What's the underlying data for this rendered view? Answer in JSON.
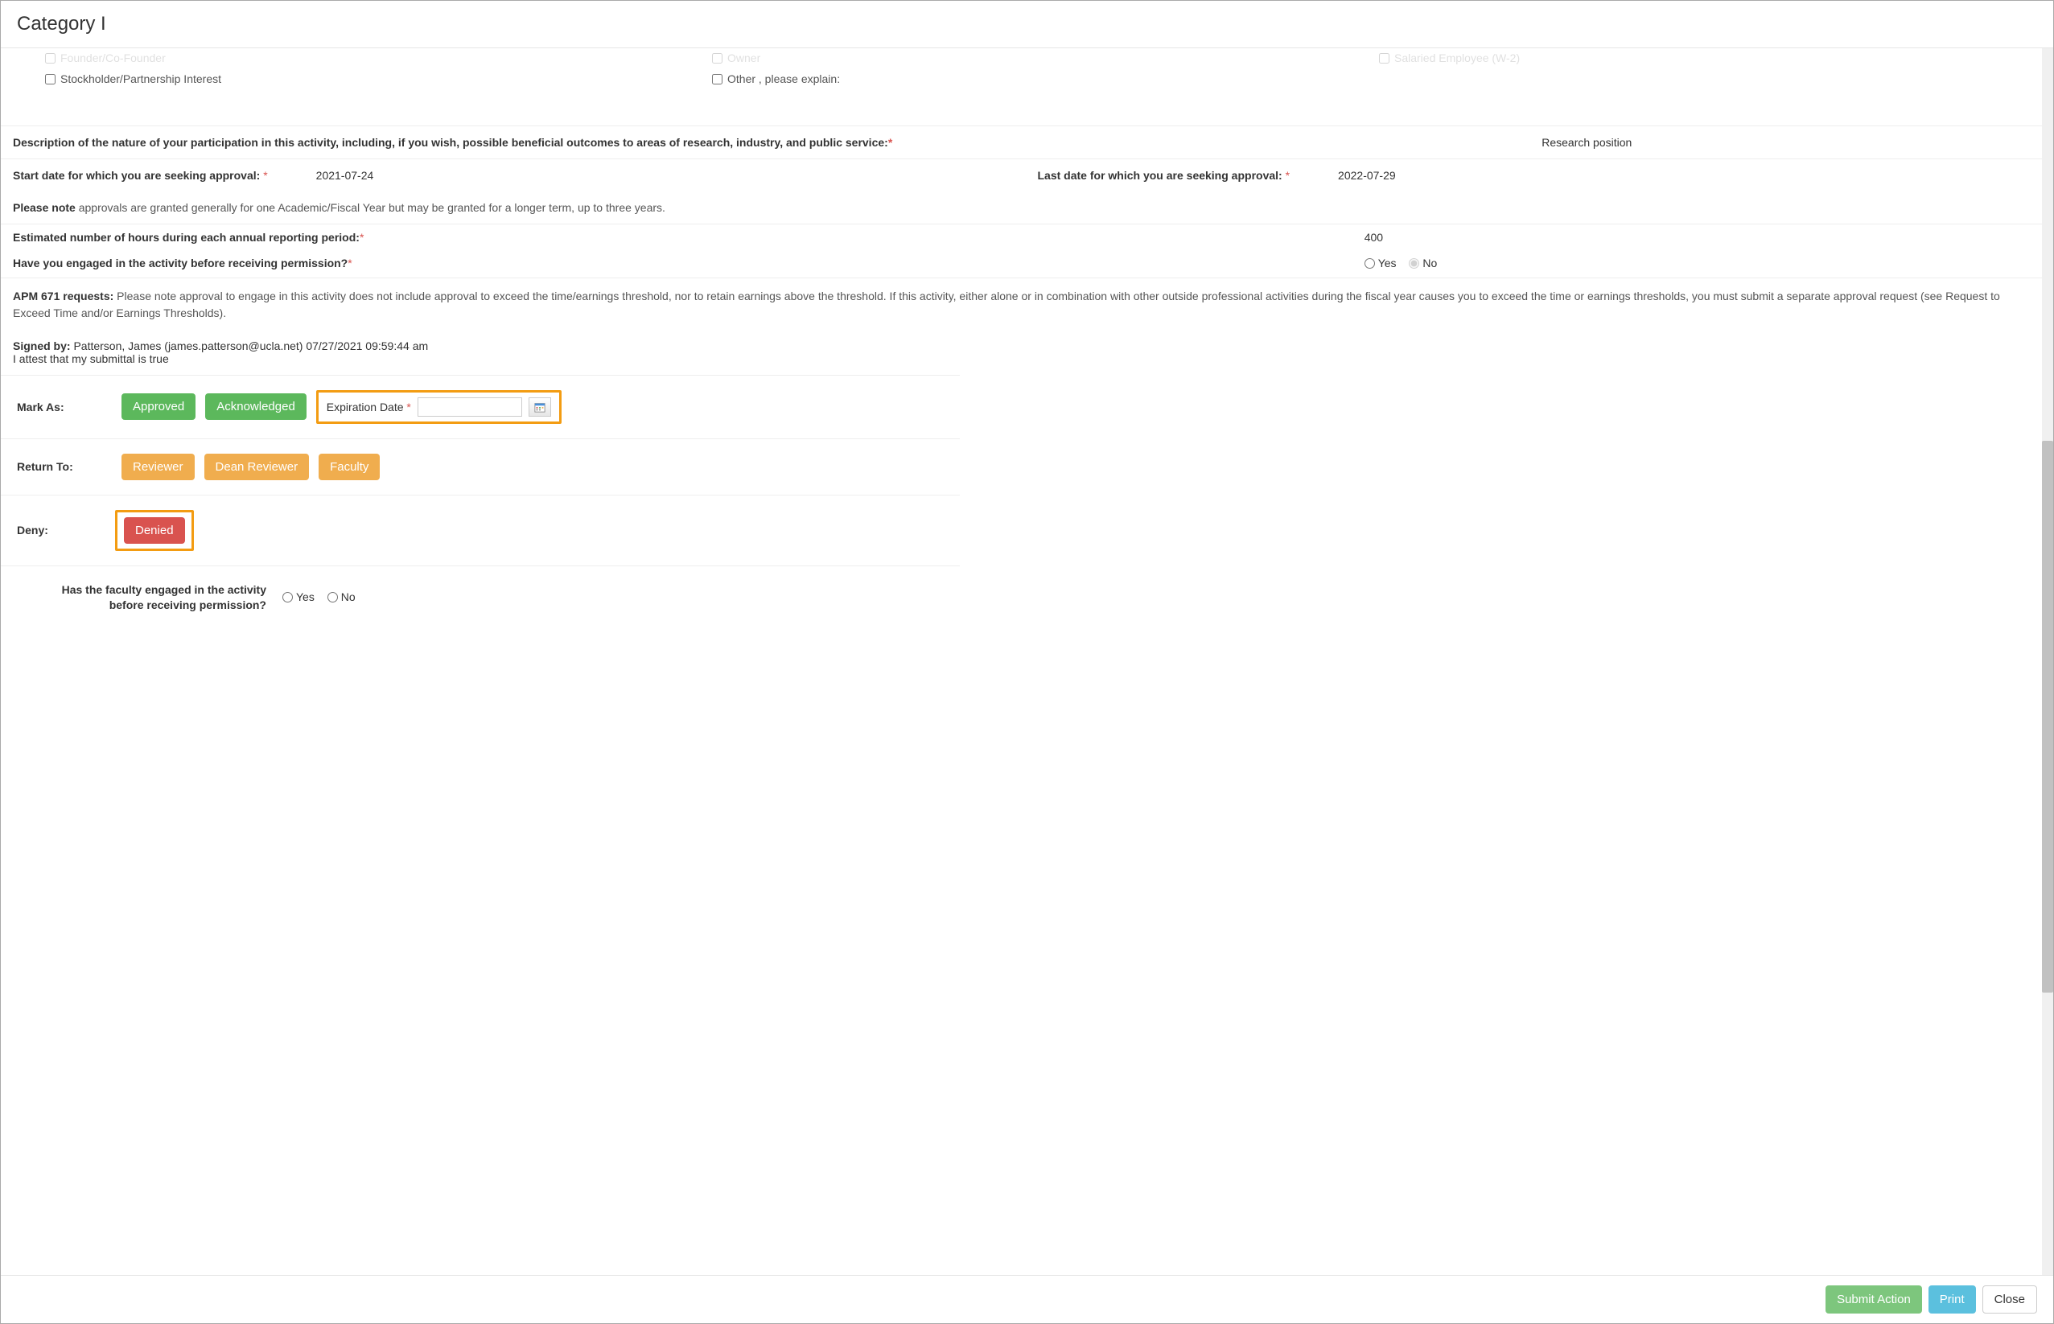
{
  "modal": {
    "title": "Category I"
  },
  "checkboxes": {
    "founder": "Founder/Co-Founder",
    "stockholder": "Stockholder/Partnership Interest",
    "owner": "Owner",
    "other": "Other , please explain:",
    "salaried": "Salaried Employee (W-2)"
  },
  "description": {
    "label": "Description of the nature of your participation in this activity, including, if you wish, possible beneficial outcomes to areas of research, industry, and public service:",
    "value": "Research position"
  },
  "dates": {
    "start_label": "Start date for which you are seeking approval: ",
    "start_value": "2021-07-24",
    "end_label": "Last date for which you are seeking approval: ",
    "end_value": "2022-07-29"
  },
  "note": {
    "bold": "Please note",
    "text": " approvals are granted generally for one Academic/Fiscal Year but may be granted for a longer term, up to three years."
  },
  "hours": {
    "label": "Estimated number of hours during each annual reporting period:",
    "value": "400"
  },
  "engaged": {
    "label": "Have you engaged in the activity before receiving permission?",
    "yes": "Yes",
    "no": "No"
  },
  "apm": {
    "bold": "APM 671 requests:",
    "text": " Please note approval to engage in this activity does not include approval to exceed the time/earnings threshold, nor to retain earnings above the threshold. If this activity, either alone or in combination with other outside professional activities during the fiscal year causes you to exceed the time or earnings thresholds, you must submit a separate approval request (see Request to Exceed Time and/or Earnings Thresholds)."
  },
  "signed": {
    "by_label": "Signed by:",
    "by_value": " Patterson, James (james.patterson@ucla.net) 07/27/2021 09:59:44 am",
    "attest": "I attest that my submittal is true"
  },
  "mark_as": {
    "label": "Mark As:",
    "approved": "Approved",
    "acknowledged": "Acknowledged",
    "expiration_label": "Expiration Date"
  },
  "return_to": {
    "label": "Return To:",
    "reviewer": "Reviewer",
    "dean": "Dean Reviewer",
    "faculty": "Faculty"
  },
  "deny": {
    "label": "Deny:",
    "denied": "Denied"
  },
  "confirm": {
    "label": "Has the faculty engaged in the activity before receiving permission?",
    "yes": "Yes",
    "no": "No"
  },
  "footer": {
    "submit": "Submit Action",
    "print": "Print",
    "close": "Close"
  }
}
